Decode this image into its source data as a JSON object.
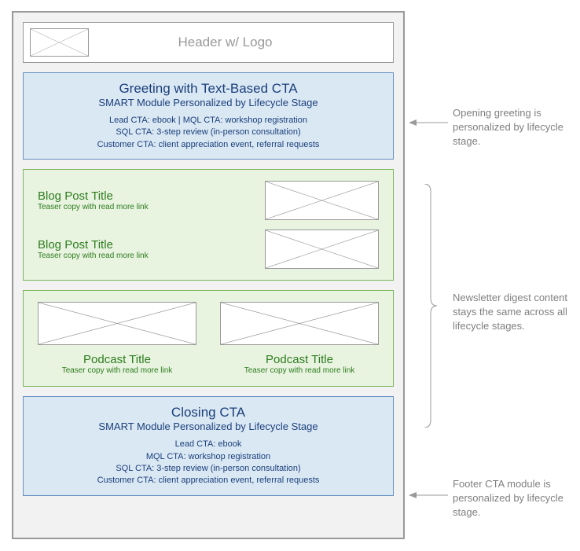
{
  "header": {
    "text": "Header w/ Logo"
  },
  "greeting": {
    "title": "Greeting with Text-Based CTA",
    "subtitle": "SMART Module Personalized by Lifecycle Stage",
    "line1": "Lead CTA: ebook  |  MQL CTA: workshop registration",
    "line2": "SQL CTA: 3-step review (in-person consultation)",
    "line3": "Customer CTA: client appreciation event, referral requests"
  },
  "blogs": {
    "post1": {
      "title": "Blog Post Title",
      "teaser": "Teaser copy with read more link"
    },
    "post2": {
      "title": "Blog Post Title",
      "teaser": "Teaser copy with read more link"
    }
  },
  "podcasts": {
    "pod1": {
      "title": "Podcast Title",
      "teaser": "Teaser copy with read more link"
    },
    "pod2": {
      "title": "Podcast Title",
      "teaser": "Teaser copy with read more link"
    }
  },
  "closing": {
    "title": "Closing CTA",
    "subtitle": "SMART Module Personalized by Lifecycle Stage",
    "line1": "Lead CTA: ebook",
    "line2": "MQL CTA: workshop registration",
    "line3": "SQL CTA: 3-step review (in-person consultation)",
    "line4": "Customer CTA: client appreciation event, referral requests"
  },
  "annotations": {
    "a1": "Opening greeting is personalized by lifecycle stage.",
    "a2": "Newsletter digest content stays the same across all lifecycle stages.",
    "a3": "Footer CTA module is personalized by lifecycle stage."
  }
}
